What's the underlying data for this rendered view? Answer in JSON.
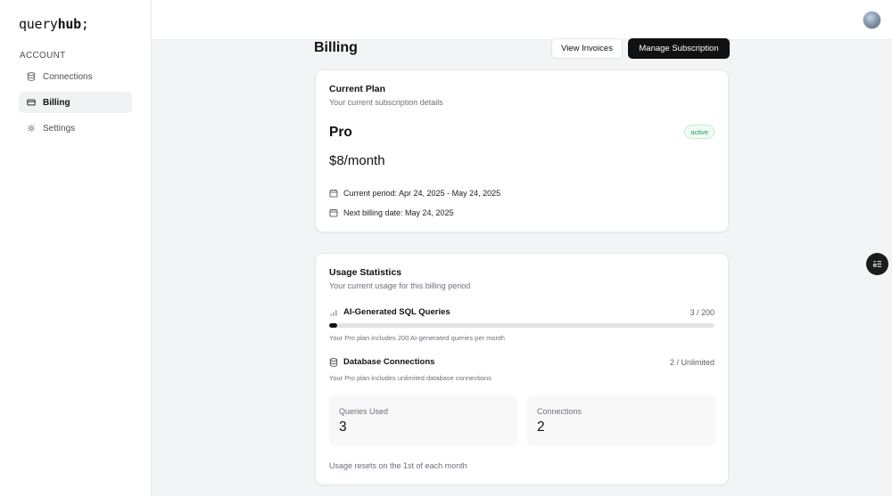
{
  "app": {
    "logo_prefix": "query",
    "logo_bold": "hub",
    "logo_suffix": ";"
  },
  "sidebar": {
    "section_label": "ACCOUNT",
    "items": [
      {
        "label": "Connections",
        "icon": "database-icon",
        "active": false
      },
      {
        "label": "Billing",
        "icon": "credit-card-icon",
        "active": true
      },
      {
        "label": "Settings",
        "icon": "gear-icon",
        "active": false
      }
    ]
  },
  "header": {
    "title": "Billing",
    "view_invoices_label": "View Invoices",
    "manage_subscription_label": "Manage Subscription"
  },
  "plan_card": {
    "title": "Current Plan",
    "subtitle": "Your current subscription details",
    "plan_name": "Pro",
    "status": "active",
    "price": "$8/month",
    "current_period": "Current period: Apr 24, 2025 - May 24, 2025",
    "next_billing": "Next billing date: May 24, 2025"
  },
  "usage_card": {
    "title": "Usage Statistics",
    "subtitle": "Your current usage for this billing period",
    "queries": {
      "label": "AI-Generated SQL Queries",
      "value": "3 / 200",
      "used": 3,
      "limit": 200,
      "note": "Your Pro plan includes 200 AI-generated queries per month"
    },
    "connections": {
      "label": "Database Connections",
      "value": "2 / Unlimited",
      "note": "Your Pro plan includes unlimited database connections"
    },
    "stats": [
      {
        "label": "Queries Used",
        "value": "3"
      },
      {
        "label": "Connections",
        "value": "2"
      }
    ],
    "reset_note": "Usage resets on the 1st of each month"
  },
  "colors": {
    "accent": "#111111",
    "active_badge": "#1f9d52",
    "background": "#f3f4f5"
  }
}
